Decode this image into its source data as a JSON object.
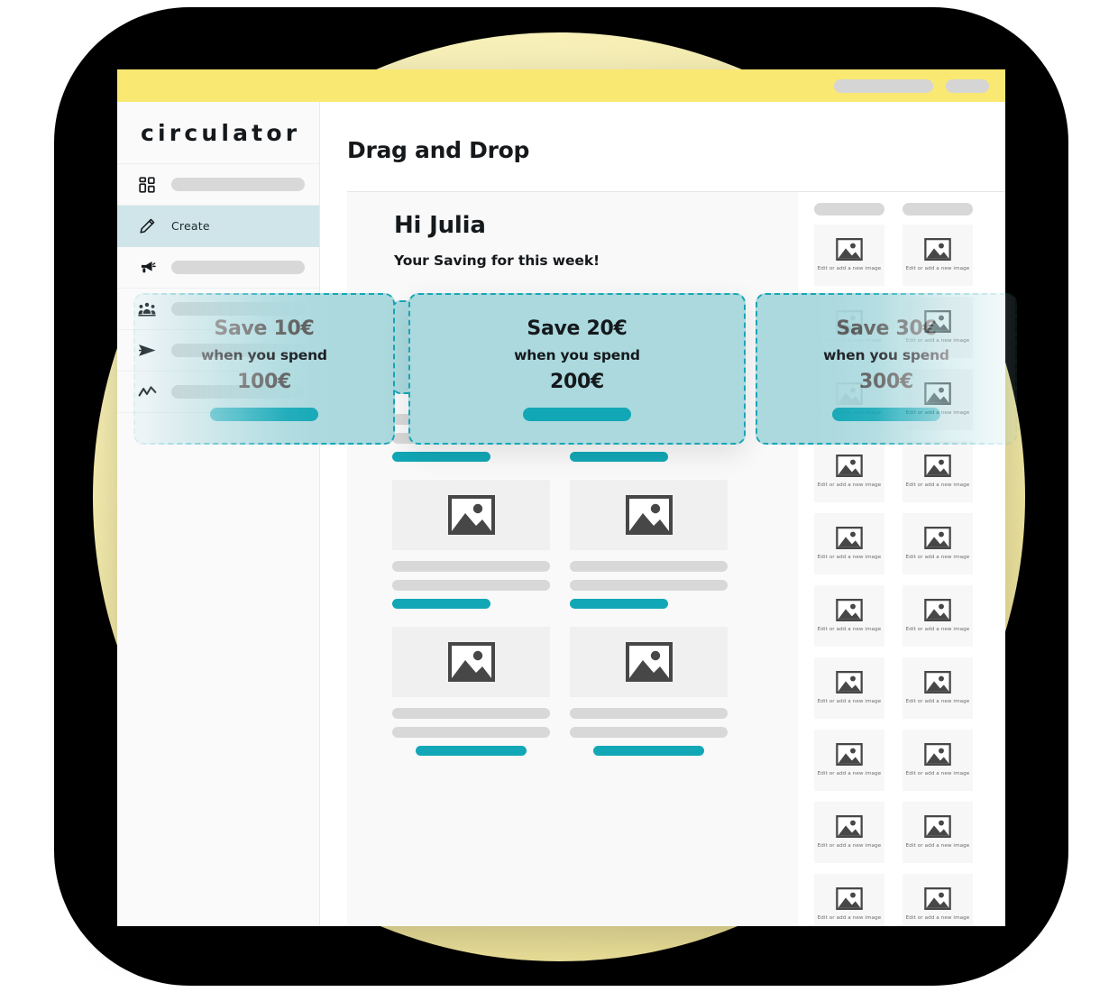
{
  "window": {
    "topbar": {
      "pill_wide": "",
      "pill_narrow": ""
    }
  },
  "sidebar": {
    "brand": "circulator",
    "items": [
      {
        "label": "",
        "icon": "dashboard-grid-icon",
        "active": false
      },
      {
        "label": "Create",
        "icon": "pencil-icon",
        "active": true
      },
      {
        "label": "",
        "icon": "megaphone-icon",
        "active": false
      },
      {
        "label": "",
        "icon": "audience-people-icon",
        "active": false
      },
      {
        "label": "",
        "icon": "paper-plane-send-icon",
        "active": false
      },
      {
        "label": "",
        "icon": "analytics-line-icon",
        "active": false
      }
    ]
  },
  "main": {
    "page_title": "Drag and Drop",
    "greeting": "Hi Julia",
    "subheading": "Your Saving for this week!"
  },
  "drag_cards": [
    {
      "id": "card-left",
      "save": "Save 10€",
      "when": "when you spend",
      "amount": "100€",
      "cta": ""
    },
    {
      "id": "card-mid",
      "save": "Save 20€",
      "when": "when you spend",
      "amount": "200€",
      "cta": ""
    },
    {
      "id": "card-right",
      "save": "Save 30€",
      "when": "when you spend",
      "amount": "300€",
      "cta": ""
    }
  ],
  "assets": {
    "caption": "Edit or add a new image",
    "header_pills": [
      "",
      ""
    ],
    "count": 20
  },
  "colors": {
    "brand_yellow": "#f9e871",
    "teal_accent": "#12a7b6",
    "card_fill": "#abd9de",
    "dashed_border": "#18a6b5",
    "sidebar_active": "#cfe5e9",
    "placeholder_grey": "#d8d8d8",
    "canvas_grey": "#f9f9fa",
    "blob_black": "#000000",
    "blob_yellow": "#f2e9a5"
  }
}
